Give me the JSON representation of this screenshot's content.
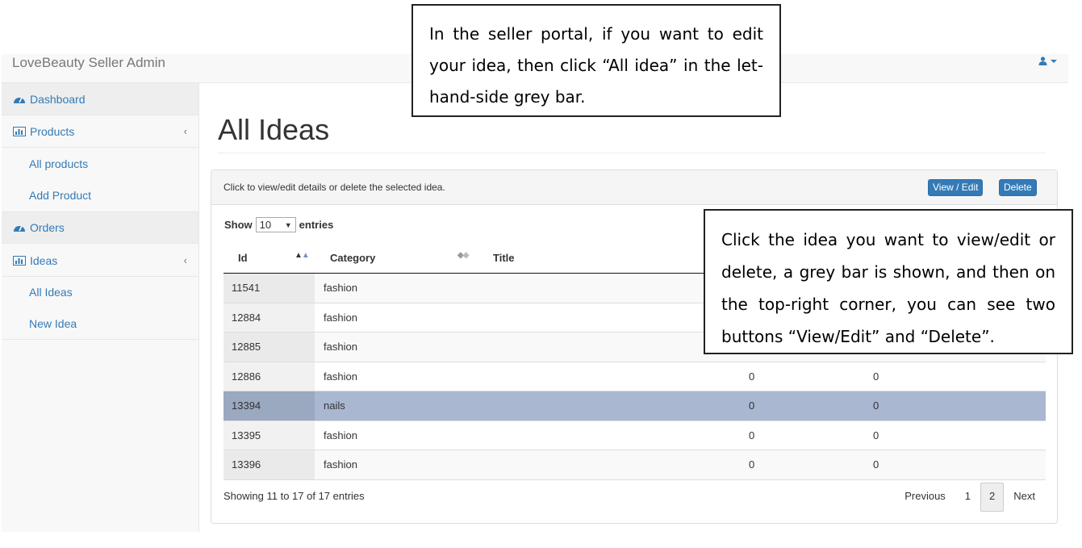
{
  "app": {
    "brand": "LoveBeauty Seller Admin"
  },
  "sidebar": {
    "items": [
      {
        "label": "Dashboard",
        "icon": "dashboard-icon"
      },
      {
        "label": "Products",
        "icon": "bar-chart-icon",
        "chevron": "‹"
      },
      {
        "label": "All products"
      },
      {
        "label": "Add Product"
      },
      {
        "label": "Orders",
        "icon": "dashboard-icon"
      },
      {
        "label": "Ideas",
        "icon": "bar-chart-icon",
        "chevron": "‹"
      },
      {
        "label": "All Ideas"
      },
      {
        "label": "New Idea"
      }
    ]
  },
  "main": {
    "title": "All Ideas",
    "panel_hint": "Click to view/edit details or delete the selected idea.",
    "view_edit_label": "View / Edit",
    "delete_label": "Delete",
    "show_label": "Show",
    "entries_label": "entries",
    "page_length": "10",
    "columns": {
      "id": "Id",
      "category": "Category",
      "title": "Title"
    },
    "rows": [
      {
        "id": "11541",
        "category": "fashion",
        "c3": "",
        "c4": ""
      },
      {
        "id": "12884",
        "category": "fashion",
        "c3": "",
        "c4": ""
      },
      {
        "id": "12885",
        "category": "fashion",
        "c3": "",
        "c4": ""
      },
      {
        "id": "12886",
        "category": "fashion",
        "c3": "0",
        "c4": "0"
      },
      {
        "id": "13394",
        "category": "nails",
        "c3": "0",
        "c4": "0",
        "selected": true
      },
      {
        "id": "13395",
        "category": "fashion",
        "c3": "0",
        "c4": "0"
      },
      {
        "id": "13396",
        "category": "fashion",
        "c3": "0",
        "c4": "0"
      }
    ],
    "info": "Showing 11 to 17 of 17 entries",
    "pagination": {
      "previous": "Previous",
      "pages": [
        "1",
        "2"
      ],
      "current": "2",
      "next": "Next"
    }
  },
  "callouts": {
    "top": "In the seller portal, if you want to edit your idea, then click “All idea” in the let-hand-side grey bar.",
    "right": "Click the idea you want to view/edit or delete, a grey bar is shown, and then on the top-right corner, you can see two buttons “View/Edit” and “Delete”."
  },
  "colors": {
    "link": "#337ab7",
    "selected_row": "#a9b7d1",
    "button": "#337ab7"
  }
}
